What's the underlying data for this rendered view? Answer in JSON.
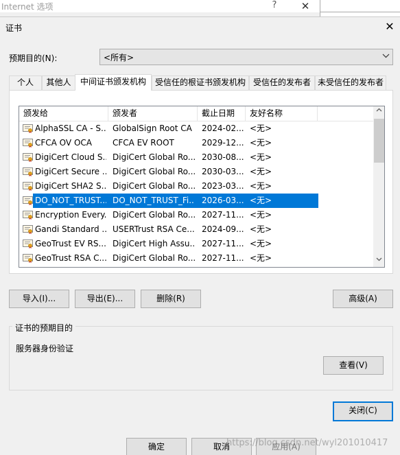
{
  "background_window": {
    "title": "Internet 选项",
    "help_label": "?",
    "close_label": "✕"
  },
  "dialog": {
    "title": "证书",
    "close_label": "✕",
    "purpose_label": "预期目的(N):",
    "purpose_value": "<所有>",
    "tabs": [
      "个人",
      "其他人",
      "中间证书颁发机构",
      "受信任的根证书颁发机构",
      "受信任的发布者",
      "未受信任的发布者"
    ],
    "active_tab": 2,
    "columns": [
      "颁发给",
      "颁发者",
      "截止日期",
      "友好名称"
    ],
    "rows": [
      {
        "issued_to": "AlphaSSL CA - S...",
        "issued_by": "GlobalSign Root CA",
        "expires": "2024-02...",
        "friendly": "<无>"
      },
      {
        "issued_to": "CFCA OV OCA",
        "issued_by": "CFCA EV ROOT",
        "expires": "2029-12...",
        "friendly": "<无>"
      },
      {
        "issued_to": "DigiCert Cloud S...",
        "issued_by": "DigiCert Global Ro...",
        "expires": "2030-08...",
        "friendly": "<无>"
      },
      {
        "issued_to": "DigiCert Secure ...",
        "issued_by": "DigiCert Global Ro...",
        "expires": "2030-03...",
        "friendly": "<无>"
      },
      {
        "issued_to": "DigiCert SHA2 S...",
        "issued_by": "DigiCert Global Ro...",
        "expires": "2023-03...",
        "friendly": "<无>"
      },
      {
        "issued_to": "DO_NOT_TRUST...",
        "issued_by": "DO_NOT_TRUST_Fi...",
        "expires": "2026-03...",
        "friendly": "<无>",
        "selected": true
      },
      {
        "issued_to": "Encryption Every...",
        "issued_by": "DigiCert Global Ro...",
        "expires": "2027-11...",
        "friendly": "<无>"
      },
      {
        "issued_to": "Gandi Standard ...",
        "issued_by": "USERTrust RSA Ce...",
        "expires": "2024-09...",
        "friendly": "<无>"
      },
      {
        "issued_to": "GeoTrust EV RS...",
        "issued_by": "DigiCert High Assu...",
        "expires": "2027-11...",
        "friendly": "<无>"
      },
      {
        "issued_to": "GeoTrust RSA C...",
        "issued_by": "DigiCert Global Ro...",
        "expires": "2027-11...",
        "friendly": "<无>"
      }
    ],
    "buttons": {
      "import": "导入(I)...",
      "export": "导出(E)...",
      "remove": "删除(R)",
      "advanced": "高级(A)",
      "view": "查看(V)",
      "close": "关闭(C)"
    },
    "purposes_group_title": "证书的预期目的",
    "purposes_text": "服务器身份验证"
  },
  "bottom_buttons": {
    "ok": "确定",
    "cancel": "取消",
    "apply": "应用(A)"
  },
  "watermark": "https://blog.csdn.net/wyl201010417",
  "colors": {
    "selection": "#0078d7",
    "dialog_bg": "#f0f0f0",
    "default_button_border": "#0078d7"
  }
}
